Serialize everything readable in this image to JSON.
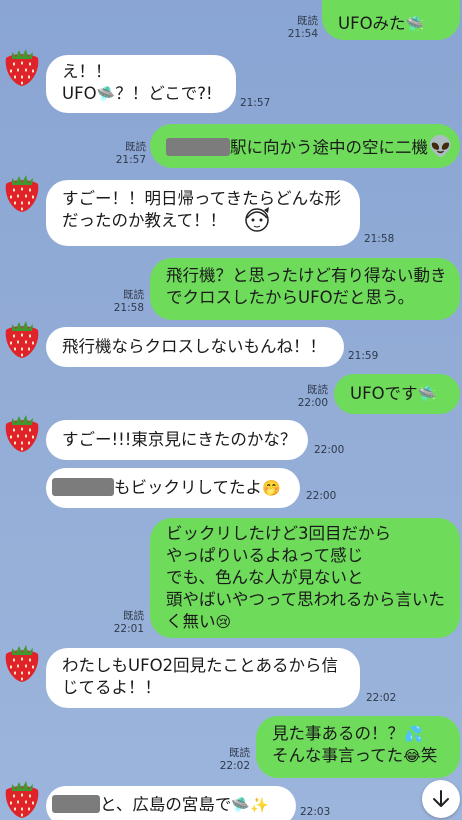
{
  "ufo_icon": "🛸",
  "messages": {
    "m1": {
      "text": "UFOみた",
      "read": "既読",
      "time": "21:54"
    },
    "m2": {
      "line1": "え！！",
      "line2a": "UFO",
      "line2b": "？！どこで?!",
      "time": "21:57"
    },
    "m3": {
      "text": "駅に向かう途中の空に二機",
      "alien": "👽",
      "read": "既読",
      "time": "21:57"
    },
    "m4": {
      "line1": "すごー！！明日帰ってきたらどんな形",
      "line2": "だったのか教えて！！",
      "time": "21:58"
    },
    "m5": {
      "line1": "飛行機？と思ったけど有り得ない動き",
      "line2": "でクロスしたからUFOだと思う。",
      "read": "既読",
      "time": "21:58"
    },
    "m6": {
      "text": "飛行機ならクロスしないもんね！！",
      "time": "21:59"
    },
    "m7": {
      "text": "UFOです",
      "read": "既読",
      "time": "22:00"
    },
    "m8": {
      "text": "すごー!!!東京見にきたのかな？",
      "time": "22:00"
    },
    "m9": {
      "text": "もビックリしてたよ",
      "emoji": "🤭",
      "time": "22:00"
    },
    "m10": {
      "line1": "ビックリしたけど3回目だから",
      "line2": "やっぱりいるよねって感じ",
      "line3": "でも、色んな人が見ないと",
      "line4": "頭やばいやつって思われるから言いた",
      "line5": "く無い",
      "emoji": "😢",
      "read": "既読",
      "time": "22:01"
    },
    "m11": {
      "line1": "わたしもUFO2回見たことあるから信",
      "line2": "じてるよ！！",
      "time": "22:02"
    },
    "m12": {
      "line1": "見た事あるの！？",
      "sweat": "💦",
      "line2": "そんな事言ってた",
      "laugh": "😂",
      "line2b": "笑",
      "read": "既読",
      "time": "22:02"
    },
    "m13": {
      "text": "と、広島の宮島で",
      "sparkle": "✨",
      "time": "22:03"
    }
  },
  "colors": {
    "incoming": "#ffffff",
    "outgoing": "#6edb5a",
    "background": "#8aa5d4"
  }
}
